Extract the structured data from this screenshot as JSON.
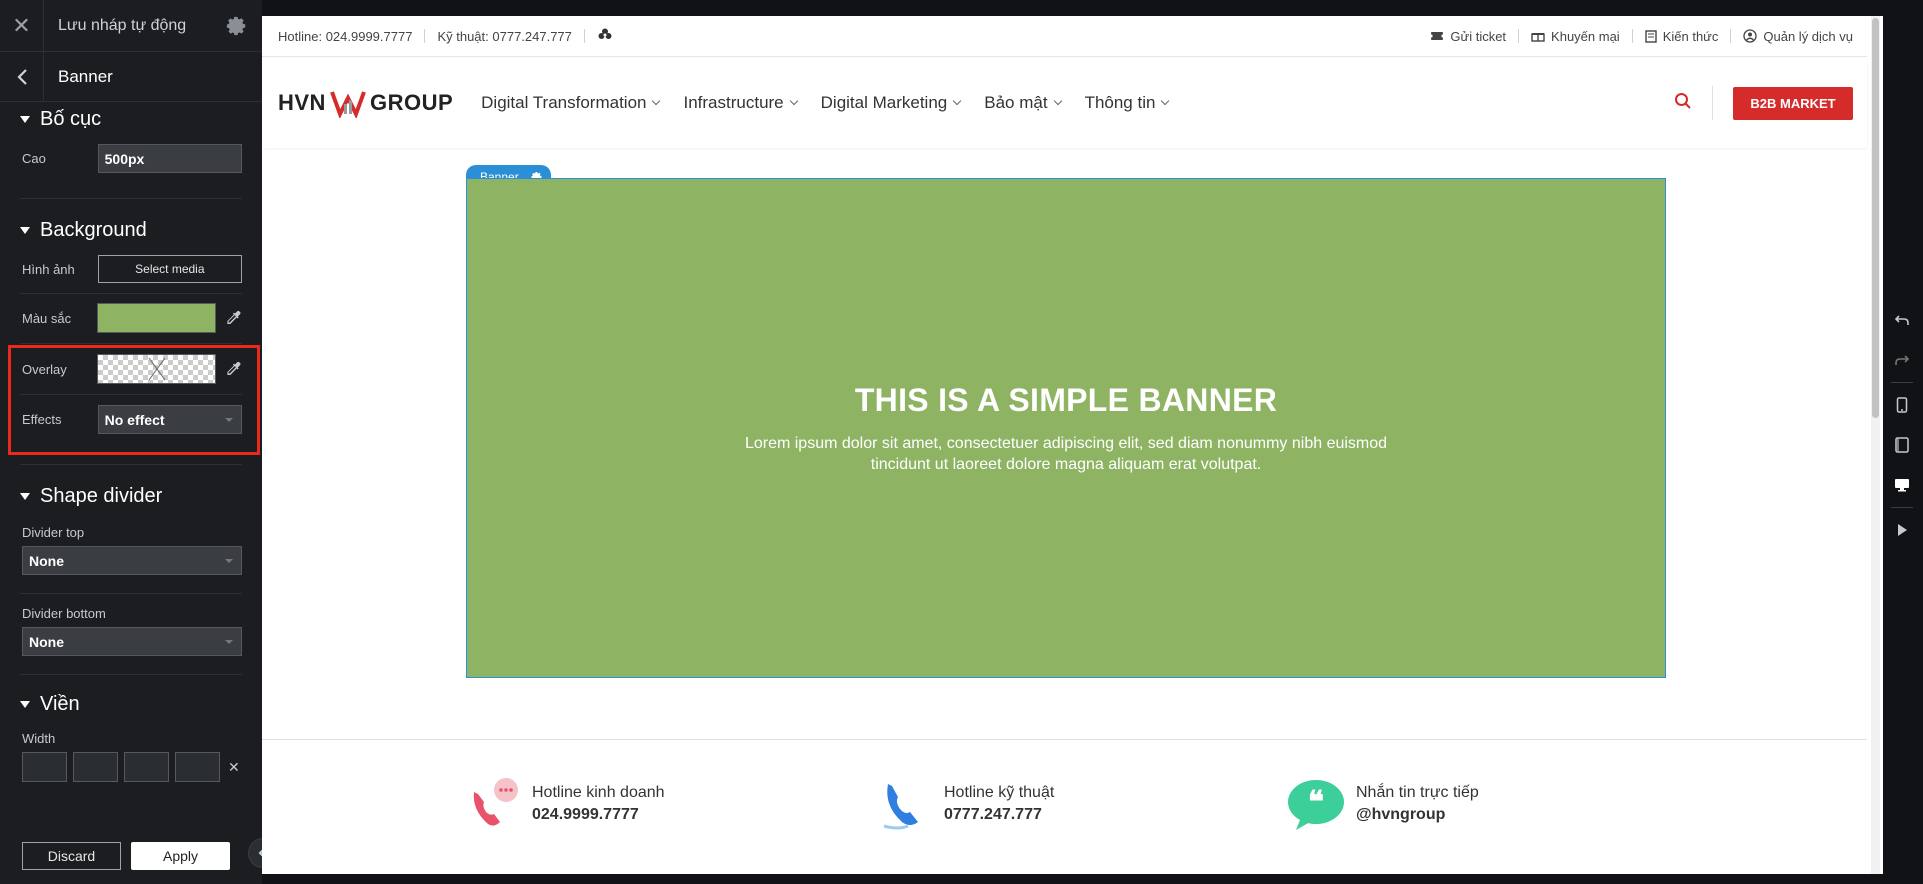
{
  "panel": {
    "draft_label": "Lưu nháp tự động",
    "title": "Banner",
    "layout": {
      "heading": "Bố cục",
      "height_label": "Cao",
      "height_value": "500px"
    },
    "background": {
      "heading": "Background",
      "image_label": "Hình ảnh",
      "select_media": "Select media",
      "color_label": "Màu sắc",
      "color_value": "#8db363",
      "overlay_label": "Overlay",
      "effects_label": "Effects",
      "effects_value": "No effect"
    },
    "shape_divider": {
      "heading": "Shape divider",
      "top_label": "Divider top",
      "top_value": "None",
      "bottom_label": "Divider bottom",
      "bottom_value": "None"
    },
    "border": {
      "heading": "Viền",
      "width_label": "Width"
    },
    "discard": "Discard",
    "apply": "Apply"
  },
  "site": {
    "hotline": "Hotline: 024.9999.7777",
    "tech": "Kỹ thuật: 0777.247.777",
    "links": [
      "Gửi ticket",
      "Khuyến mại",
      "Kiến thức",
      "Quản lý dịch vụ"
    ],
    "logo_left": "HVN",
    "logo_right": "GROUP",
    "nav": [
      "Digital Transformation",
      "Infrastructure",
      "Digital Marketing",
      "Bảo mật",
      "Thông tin"
    ],
    "b2b": "B2B MARKET",
    "banner_tag": "Banner",
    "banner_title": "THIS IS A SIMPLE BANNER",
    "banner_desc": "Lorem ipsum dolor sit amet, consectetuer adipiscing elit, sed diam nonummy nibh euismod tincidunt ut laoreet dolore magna aliquam erat volutpat.",
    "contacts": [
      {
        "label": "Hotline kinh doanh",
        "value": "024.9999.7777"
      },
      {
        "label": "Hotline kỹ thuật",
        "value": "0777.247.777"
      },
      {
        "label": "Nhắn tin trực tiếp",
        "value": "@hvngroup"
      }
    ]
  },
  "colors": {
    "accent_red": "#d62b2b",
    "banner_green": "#8db363",
    "selection_blue": "#2a8fd6"
  }
}
